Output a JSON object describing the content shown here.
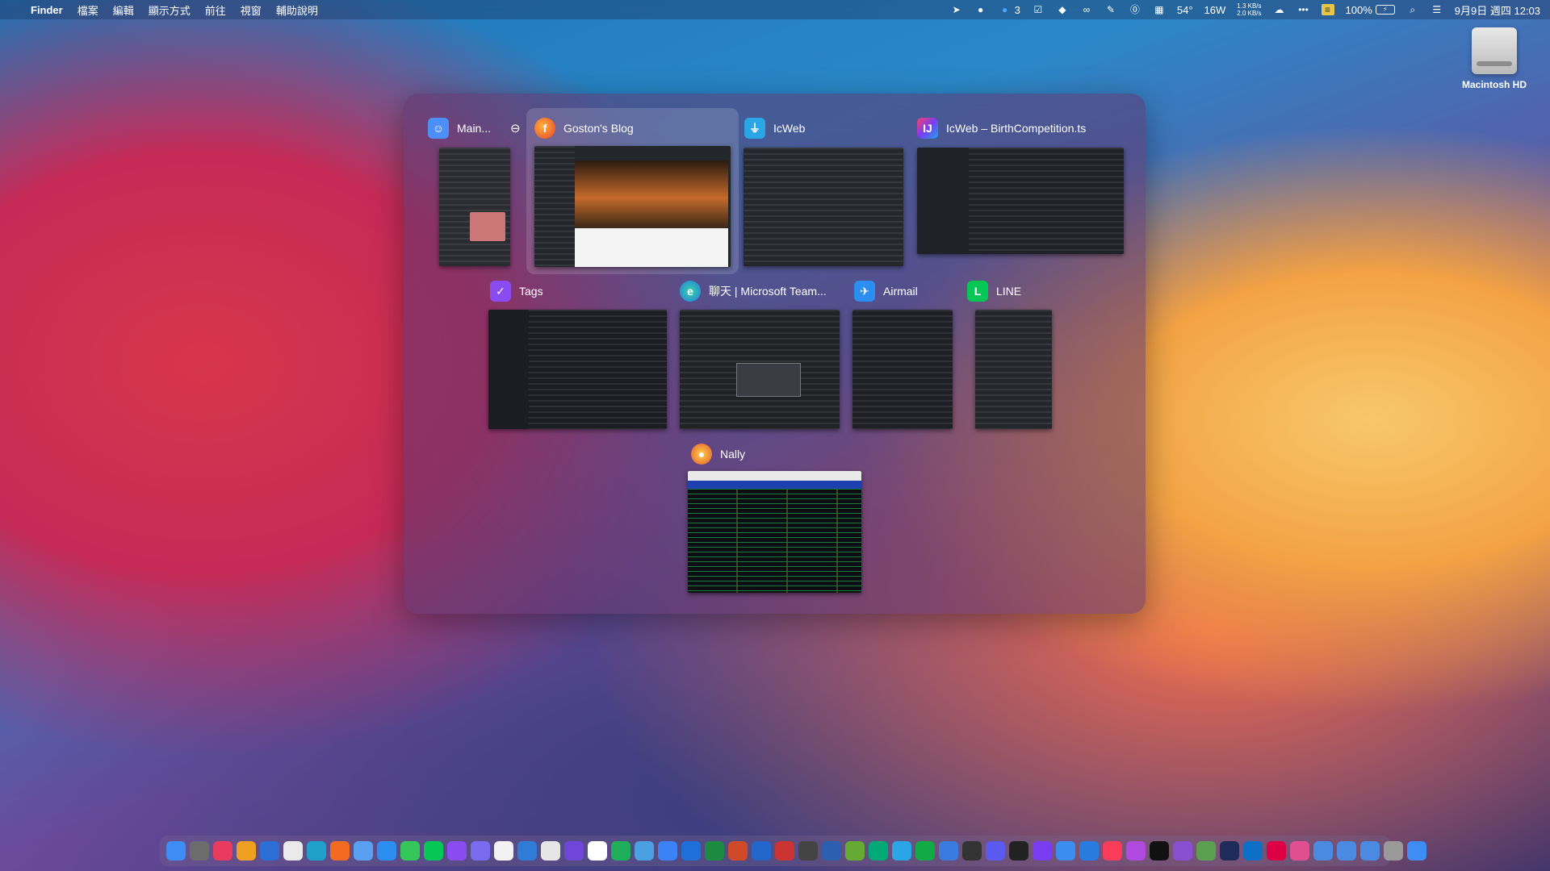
{
  "menubar": {
    "apple": "",
    "app": "Finder",
    "menus": [
      "檔案",
      "編輯",
      "顯示方式",
      "前往",
      "視窗",
      "輔助說明"
    ],
    "status": {
      "badge_count": "3",
      "temp": "54°",
      "power": "16W",
      "net_up": "1.3 KB/s",
      "net_down": "2.0 KB/s",
      "battery": "100%",
      "datetime": "9月9日 週四 12:03"
    }
  },
  "desktop": {
    "disk_label": "Macintosh HD"
  },
  "switcher": {
    "windows": [
      {
        "title": "Main...",
        "icon": "finder-icon",
        "color": "#3d8df5"
      },
      {
        "title": "Goston's Blog",
        "icon": "firefox-icon",
        "color": "#f26b21"
      },
      {
        "title": "IcWeb",
        "icon": "sourcetree-icon",
        "color": "#2aa6e6"
      },
      {
        "title": "IcWeb – BirthCompetition.ts",
        "icon": "intellij-icon",
        "color": "#7a3cf0"
      },
      {
        "title": "Tags",
        "icon": "omnifocus-icon",
        "color": "#8a4bf0"
      },
      {
        "title": "聊天 | Microsoft Team...",
        "icon": "edge-icon",
        "color": "#1fa0c8"
      },
      {
        "title": "Airmail",
        "icon": "airmail-icon",
        "color": "#2c8ef0"
      },
      {
        "title": "LINE",
        "icon": "line-icon",
        "color": "#06c755"
      },
      {
        "title": "Nally",
        "icon": "nally-icon",
        "color": "#f2892b"
      }
    ],
    "minimize_symbol": "⊖"
  },
  "dock": {
    "app_count_visible": 54
  }
}
